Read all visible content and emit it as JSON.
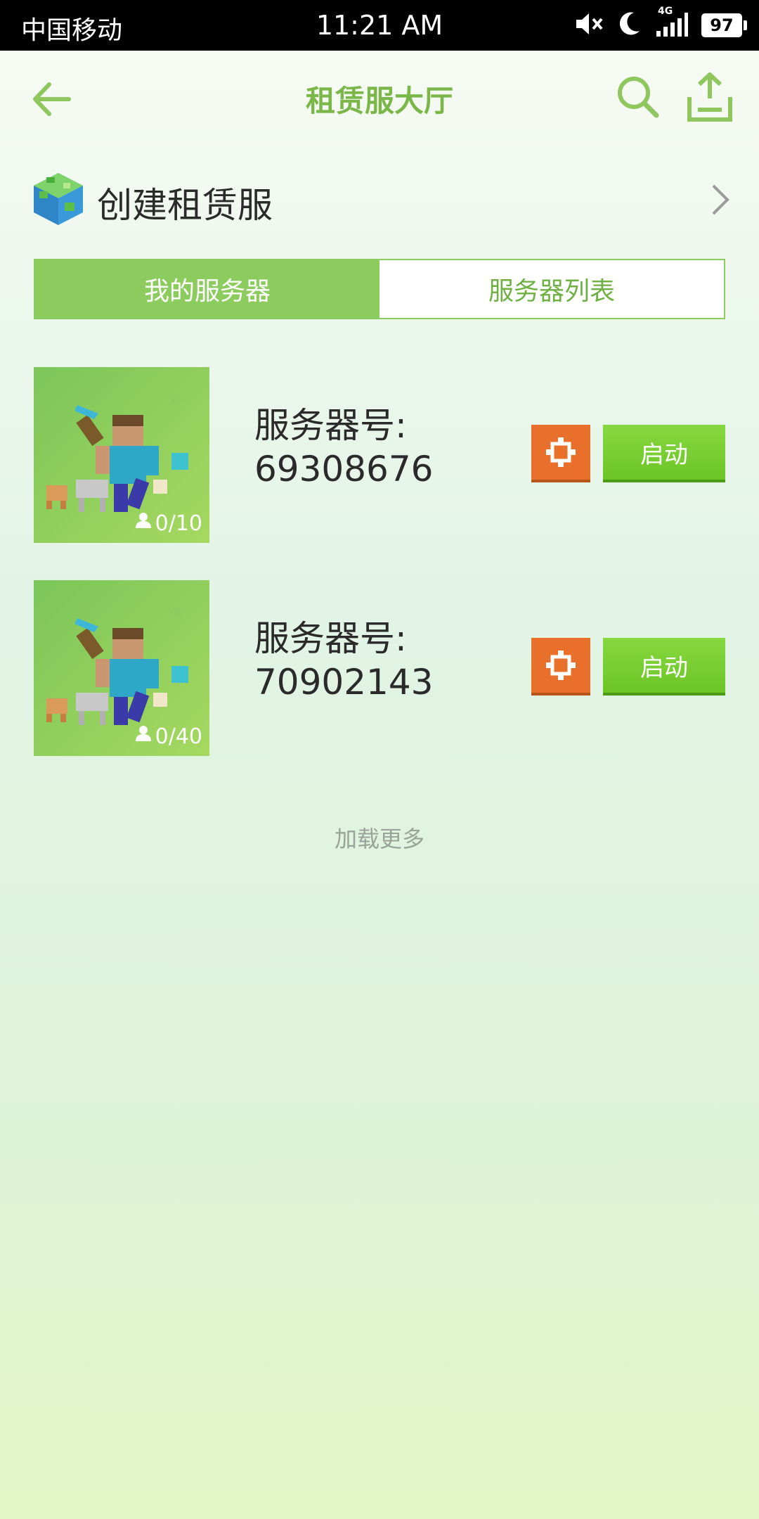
{
  "status_bar": {
    "carrier": "中国移动",
    "time": "11:21 AM",
    "network": "4G",
    "battery": "97"
  },
  "header": {
    "title": "租赁服大厅"
  },
  "create": {
    "label": "创建租赁服"
  },
  "tabs": [
    {
      "label": "我的服务器",
      "active": true
    },
    {
      "label": "服务器列表",
      "active": false
    }
  ],
  "servers": [
    {
      "label_line1": "服务器号:",
      "number": "69308676",
      "players": "0/10",
      "start_label": "启动"
    },
    {
      "label_line1": "服务器号:",
      "number": "70902143",
      "players": "0/40",
      "start_label": "启动"
    }
  ],
  "load_more": "加载更多",
  "colors": {
    "accent": "#7ab648",
    "tab_active": "#8ccc5e",
    "settings_button": "#e8702a",
    "start_button": "#6cc426"
  }
}
